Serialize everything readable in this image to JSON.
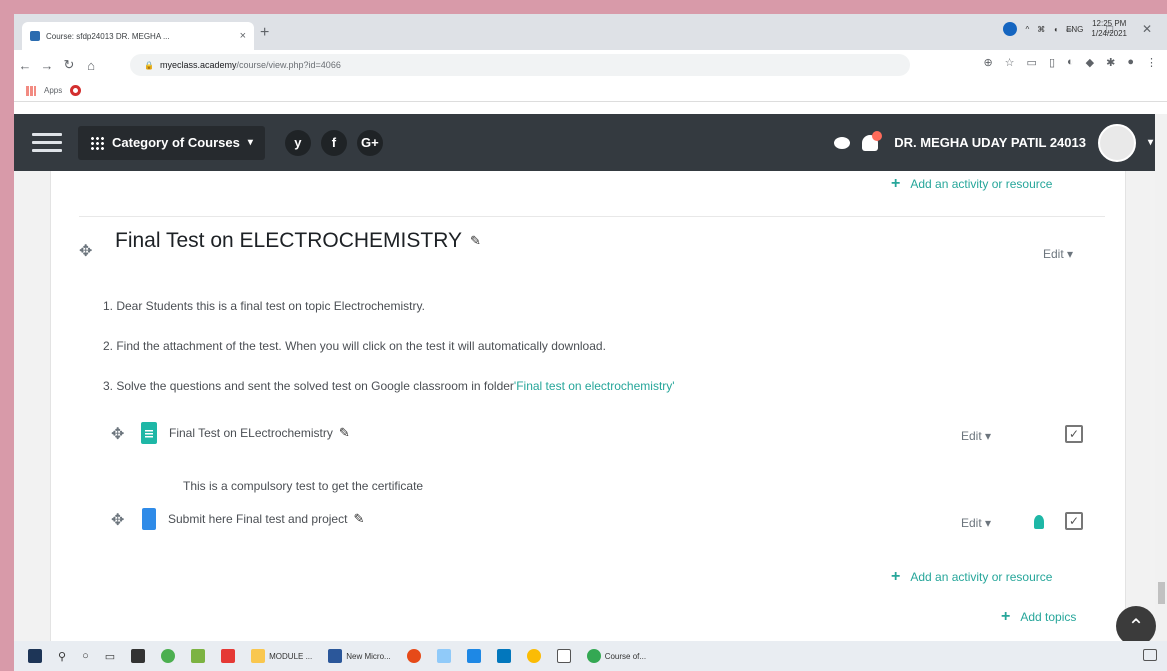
{
  "browser": {
    "tab_title": "Course: sfdp24013 DR. MEGHA ...",
    "url_domain": "myeclass.academy",
    "url_path": "/course/view.php?id=4066",
    "bookmarks_label": "Apps",
    "win_min": "–",
    "win_max": "□",
    "win_close": "✕",
    "newtab": "+",
    "tab_close": "×"
  },
  "navbar": {
    "category_label": "Category of Courses",
    "social": [
      "y",
      "f",
      "G+"
    ],
    "user_name": "DR. MEGHA UDAY PATIL 24013"
  },
  "content": {
    "add_activity_label": "Add an activity or resource",
    "section_title": "Final Test on ELECTROCHEMISTRY",
    "edit_label": "Edit",
    "summary": [
      "1. Dear Students this is a final test on topic Electrochemistry.",
      "2. Find the attachment of the test. When you will click on the test it will automatically download.",
      "3. Solve the questions and sent the solved test on Google classroom in folder"
    ],
    "summary_link": "'Final test on electrochemistry'",
    "activities": [
      {
        "title": "Final Test on ELectrochemistry",
        "description": "This is a compulsory test to get the certificate"
      },
      {
        "title": "Submit here Final test and project"
      }
    ],
    "add_topics_label": "Add topics"
  },
  "taskbar": {
    "apps": [
      "MODULE ...",
      "New Micro...",
      "Course of..."
    ],
    "language": "ENG",
    "time": "12:25 PM",
    "date": "1/24/2021"
  },
  "colors": {
    "accent": "#26a69a",
    "navbar": "#343a40"
  }
}
